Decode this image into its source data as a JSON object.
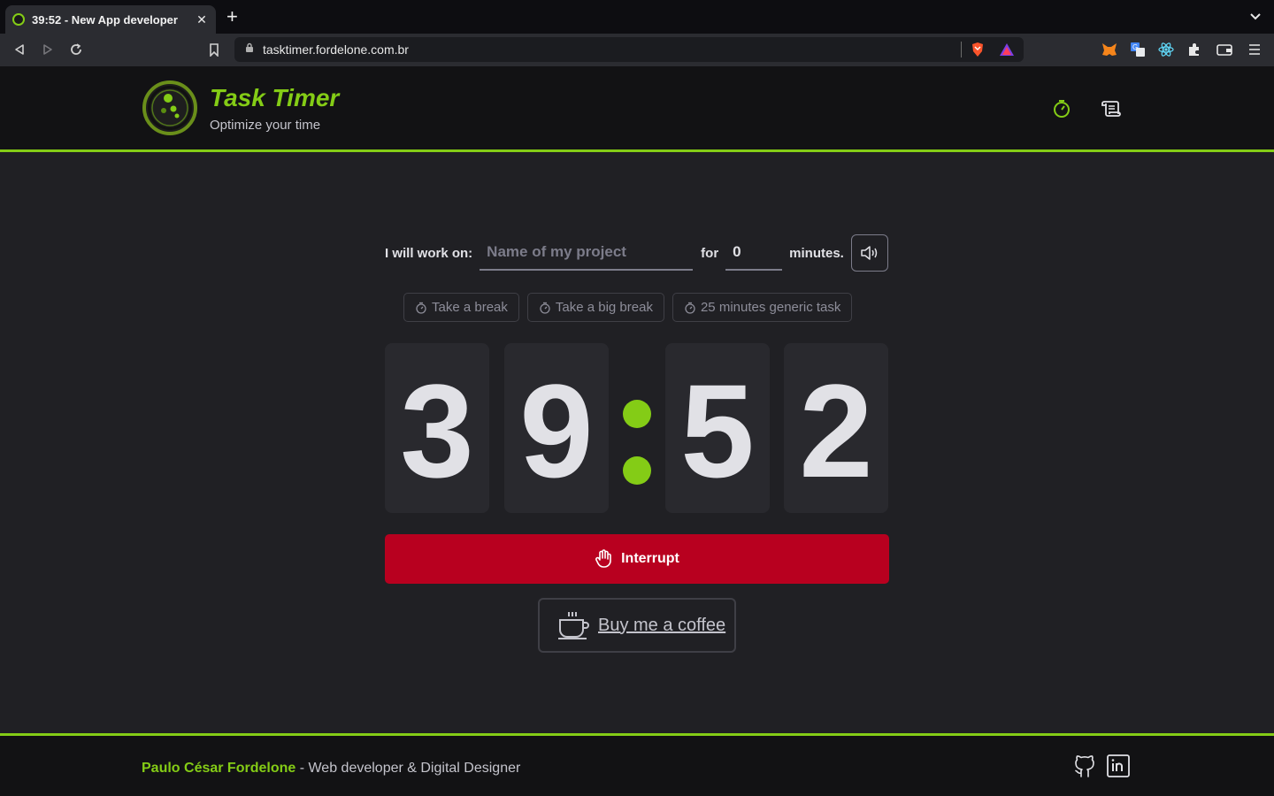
{
  "browser": {
    "tab_title": "39:52 - New App developer",
    "url": "tasktimer.fordelone.com.br"
  },
  "header": {
    "title": "Task Timer",
    "subtitle": "Optimize your time"
  },
  "form": {
    "work_label": "I will work on:",
    "task_placeholder": "Name of my project",
    "for_label": "for",
    "minutes_value": "0",
    "minutes_label": "minutes."
  },
  "presets": [
    {
      "label": "Take a break"
    },
    {
      "label": "Take a big break"
    },
    {
      "label": "25 minutes generic task"
    }
  ],
  "countdown": {
    "m1": "3",
    "m2": "9",
    "s1": "5",
    "s2": "2"
  },
  "interrupt_label": "Interrupt",
  "coffee_label": "Buy me a coffee",
  "footer": {
    "name": "Paulo César Fordelone",
    "tagline": " - Web developer & Digital Designer"
  },
  "colors": {
    "accent": "#84cc16",
    "danger": "#b8001f",
    "background": "#202024"
  }
}
